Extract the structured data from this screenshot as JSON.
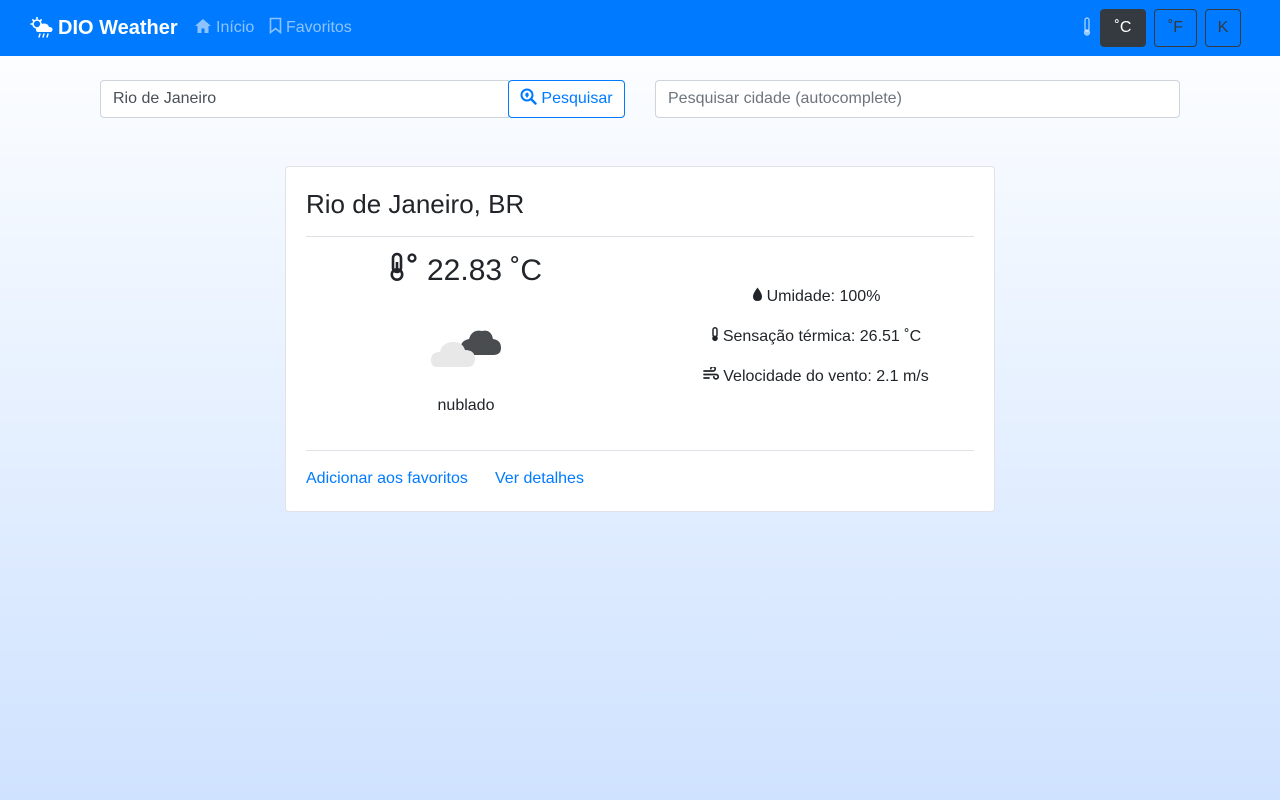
{
  "navbar": {
    "brand": "DIO Weather",
    "links": [
      {
        "label": "Início"
      },
      {
        "label": "Favoritos"
      }
    ],
    "units": [
      {
        "label": "˚C",
        "active": true
      },
      {
        "label": "˚F",
        "active": false
      },
      {
        "label": "K",
        "active": false
      }
    ]
  },
  "search": {
    "value": "Rio de Janeiro",
    "button_label": "Pesquisar",
    "autocomplete_placeholder": "Pesquisar cidade (autocomplete)"
  },
  "card": {
    "title": "Rio de Janeiro, BR",
    "temperature": "22.83 ˚C",
    "description": "nublado",
    "humidity": "Umidade: 100%",
    "feels_like": "Sensação térmica: 26.51 ˚C",
    "wind": "Velocidade do vento: 2.1 m/s",
    "add_favorite_label": "Adicionar aos favoritos",
    "details_label": "Ver detalhes"
  },
  "icons": {
    "brand": "cloud-sun-rain-icon",
    "home": "home-icon",
    "favorites": "bookmark-icon",
    "thermometer": "thermometer-icon",
    "search": "search-location-icon",
    "weather": "clouds-icon",
    "humidity": "tint-icon",
    "wind": "wind-icon"
  },
  "colors": {
    "primary": "#007bff",
    "dark": "#343a40"
  }
}
